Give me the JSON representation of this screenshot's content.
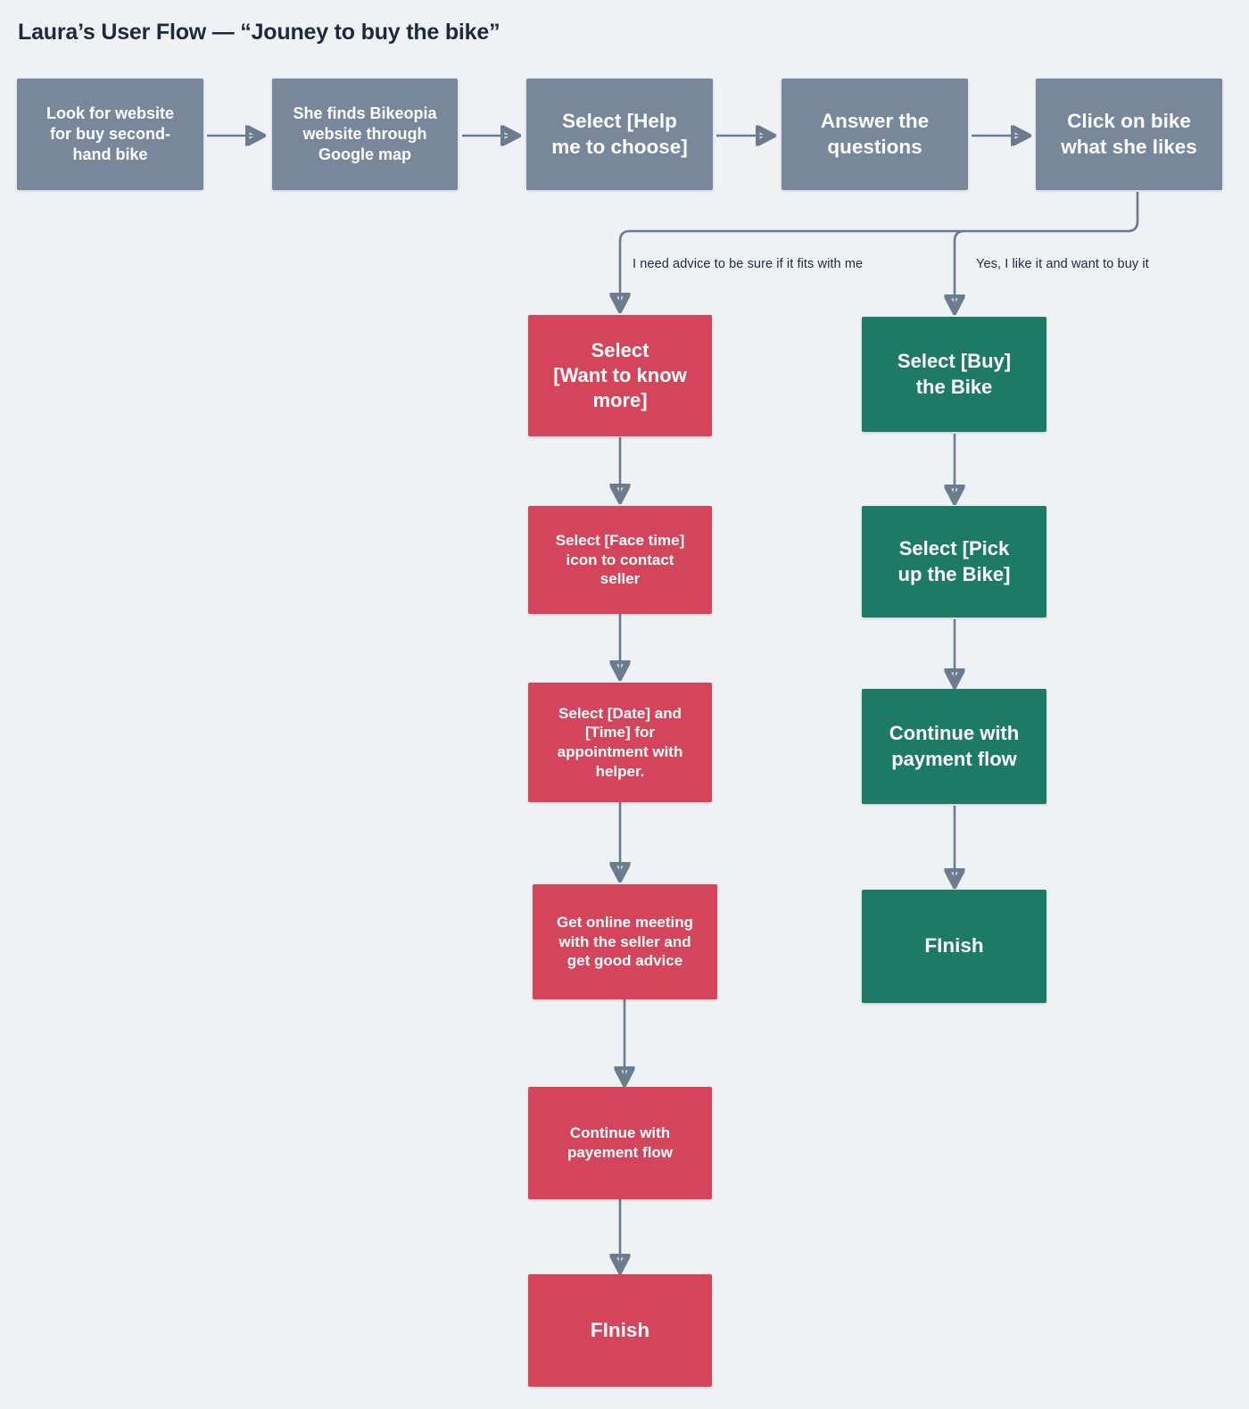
{
  "title": "Laura’s User Flow — “Jouney to buy the bike”",
  "colors": {
    "background": "#eff2f5",
    "gray_node": "#78889a",
    "red_node": "#d4455c",
    "green_node": "#1d7a64",
    "connector": "#6b7c8f",
    "title_text": "#1b2a3d",
    "node_text": "#ffffff"
  },
  "chart_data": {
    "type": "diagram",
    "title": "Laura’s User Flow — “Jouney to buy the bike”",
    "diagram_kind": "flowchart",
    "lanes": [
      "main",
      "advice-branch",
      "buy-branch"
    ],
    "nodes": [
      {
        "id": "n1",
        "label": "Look for website for buy second-hand bike",
        "lane": "main",
        "color": "gray"
      },
      {
        "id": "n2",
        "label": "She finds Bikeopia website through Google map",
        "lane": "main",
        "color": "gray"
      },
      {
        "id": "n3",
        "label": "Select [Help me to choose]",
        "lane": "main",
        "color": "gray"
      },
      {
        "id": "n4",
        "label": "Answer the questions",
        "lane": "main",
        "color": "gray"
      },
      {
        "id": "n5",
        "label": "Click on bike what she likes",
        "lane": "main",
        "color": "gray"
      },
      {
        "id": "r1",
        "label": "Select [Want to know more]",
        "lane": "advice-branch",
        "color": "red"
      },
      {
        "id": "r2",
        "label": "Select [Face time] icon to contact seller",
        "lane": "advice-branch",
        "color": "red"
      },
      {
        "id": "r3",
        "label": "Select [Date] and [Time] for appointment with helper.",
        "lane": "advice-branch",
        "color": "red"
      },
      {
        "id": "r4",
        "label": "Get online meeting with the seller and get good advice",
        "lane": "advice-branch",
        "color": "red"
      },
      {
        "id": "r5",
        "label": "Continue with payement flow",
        "lane": "advice-branch",
        "color": "red"
      },
      {
        "id": "r6",
        "label": "FInish",
        "lane": "advice-branch",
        "color": "red"
      },
      {
        "id": "g1",
        "label": "Select [Buy] the Bike",
        "lane": "buy-branch",
        "color": "green"
      },
      {
        "id": "g2",
        "label": "Select [Pick up the Bike]",
        "lane": "buy-branch",
        "color": "green"
      },
      {
        "id": "g3",
        "label": "Continue with payment flow",
        "lane": "buy-branch",
        "color": "green"
      },
      {
        "id": "g4",
        "label": "FInish",
        "lane": "buy-branch",
        "color": "green"
      }
    ],
    "edges": [
      {
        "from": "n1",
        "to": "n2",
        "label": ""
      },
      {
        "from": "n2",
        "to": "n3",
        "label": ""
      },
      {
        "from": "n3",
        "to": "n4",
        "label": ""
      },
      {
        "from": "n4",
        "to": "n5",
        "label": ""
      },
      {
        "from": "n5",
        "to": "r1",
        "label": "I need advice to be sure if it fits with me"
      },
      {
        "from": "n5",
        "to": "g1",
        "label": "Yes, I like it and want to buy it"
      },
      {
        "from": "r1",
        "to": "r2",
        "label": ""
      },
      {
        "from": "r2",
        "to": "r3",
        "label": ""
      },
      {
        "from": "r3",
        "to": "r4",
        "label": ""
      },
      {
        "from": "r4",
        "to": "r5",
        "label": ""
      },
      {
        "from": "r5",
        "to": "r6",
        "label": ""
      },
      {
        "from": "g1",
        "to": "g2",
        "label": ""
      },
      {
        "from": "g2",
        "to": "g3",
        "label": ""
      },
      {
        "from": "g3",
        "to": "g4",
        "label": ""
      }
    ]
  },
  "flow": {
    "main_row": [
      {
        "id": "n1",
        "lines": [
          "Look for website",
          "for buy second-",
          "hand bike"
        ]
      },
      {
        "id": "n2",
        "lines": [
          "She finds Bikeopia",
          "website through",
          "Google map"
        ]
      },
      {
        "id": "n3",
        "lines": [
          "Select [Help",
          "me to choose]"
        ]
      },
      {
        "id": "n4",
        "lines": [
          "Answer the",
          "questions"
        ]
      },
      {
        "id": "n5",
        "lines": [
          "Click on bike",
          "what she likes"
        ]
      }
    ],
    "branch_labels": {
      "left": "I need advice to be sure if it fits with me",
      "right": "Yes, I like it and want to buy it"
    },
    "advice_branch": [
      {
        "id": "r1",
        "lines": [
          "Select",
          "[Want to know",
          "more]"
        ]
      },
      {
        "id": "r2",
        "lines": [
          "Select [Face time]",
          "icon to contact",
          "seller"
        ]
      },
      {
        "id": "r3",
        "lines": [
          "Select [Date] and",
          "[Time] for",
          "appointment with",
          "helper."
        ]
      },
      {
        "id": "r4",
        "lines": [
          "Get online meeting",
          "with the seller and",
          "get good advice"
        ]
      },
      {
        "id": "r5",
        "lines": [
          "Continue with",
          "payement flow"
        ]
      },
      {
        "id": "r6",
        "lines": [
          "FInish"
        ]
      }
    ],
    "buy_branch": [
      {
        "id": "g1",
        "lines": [
          "Select [Buy]",
          "the Bike"
        ]
      },
      {
        "id": "g2",
        "lines": [
          "Select [Pick",
          "up the Bike]"
        ]
      },
      {
        "id": "g3",
        "lines": [
          "Continue with",
          "payment flow"
        ]
      },
      {
        "id": "g4",
        "lines": [
          "FInish"
        ]
      }
    ]
  }
}
